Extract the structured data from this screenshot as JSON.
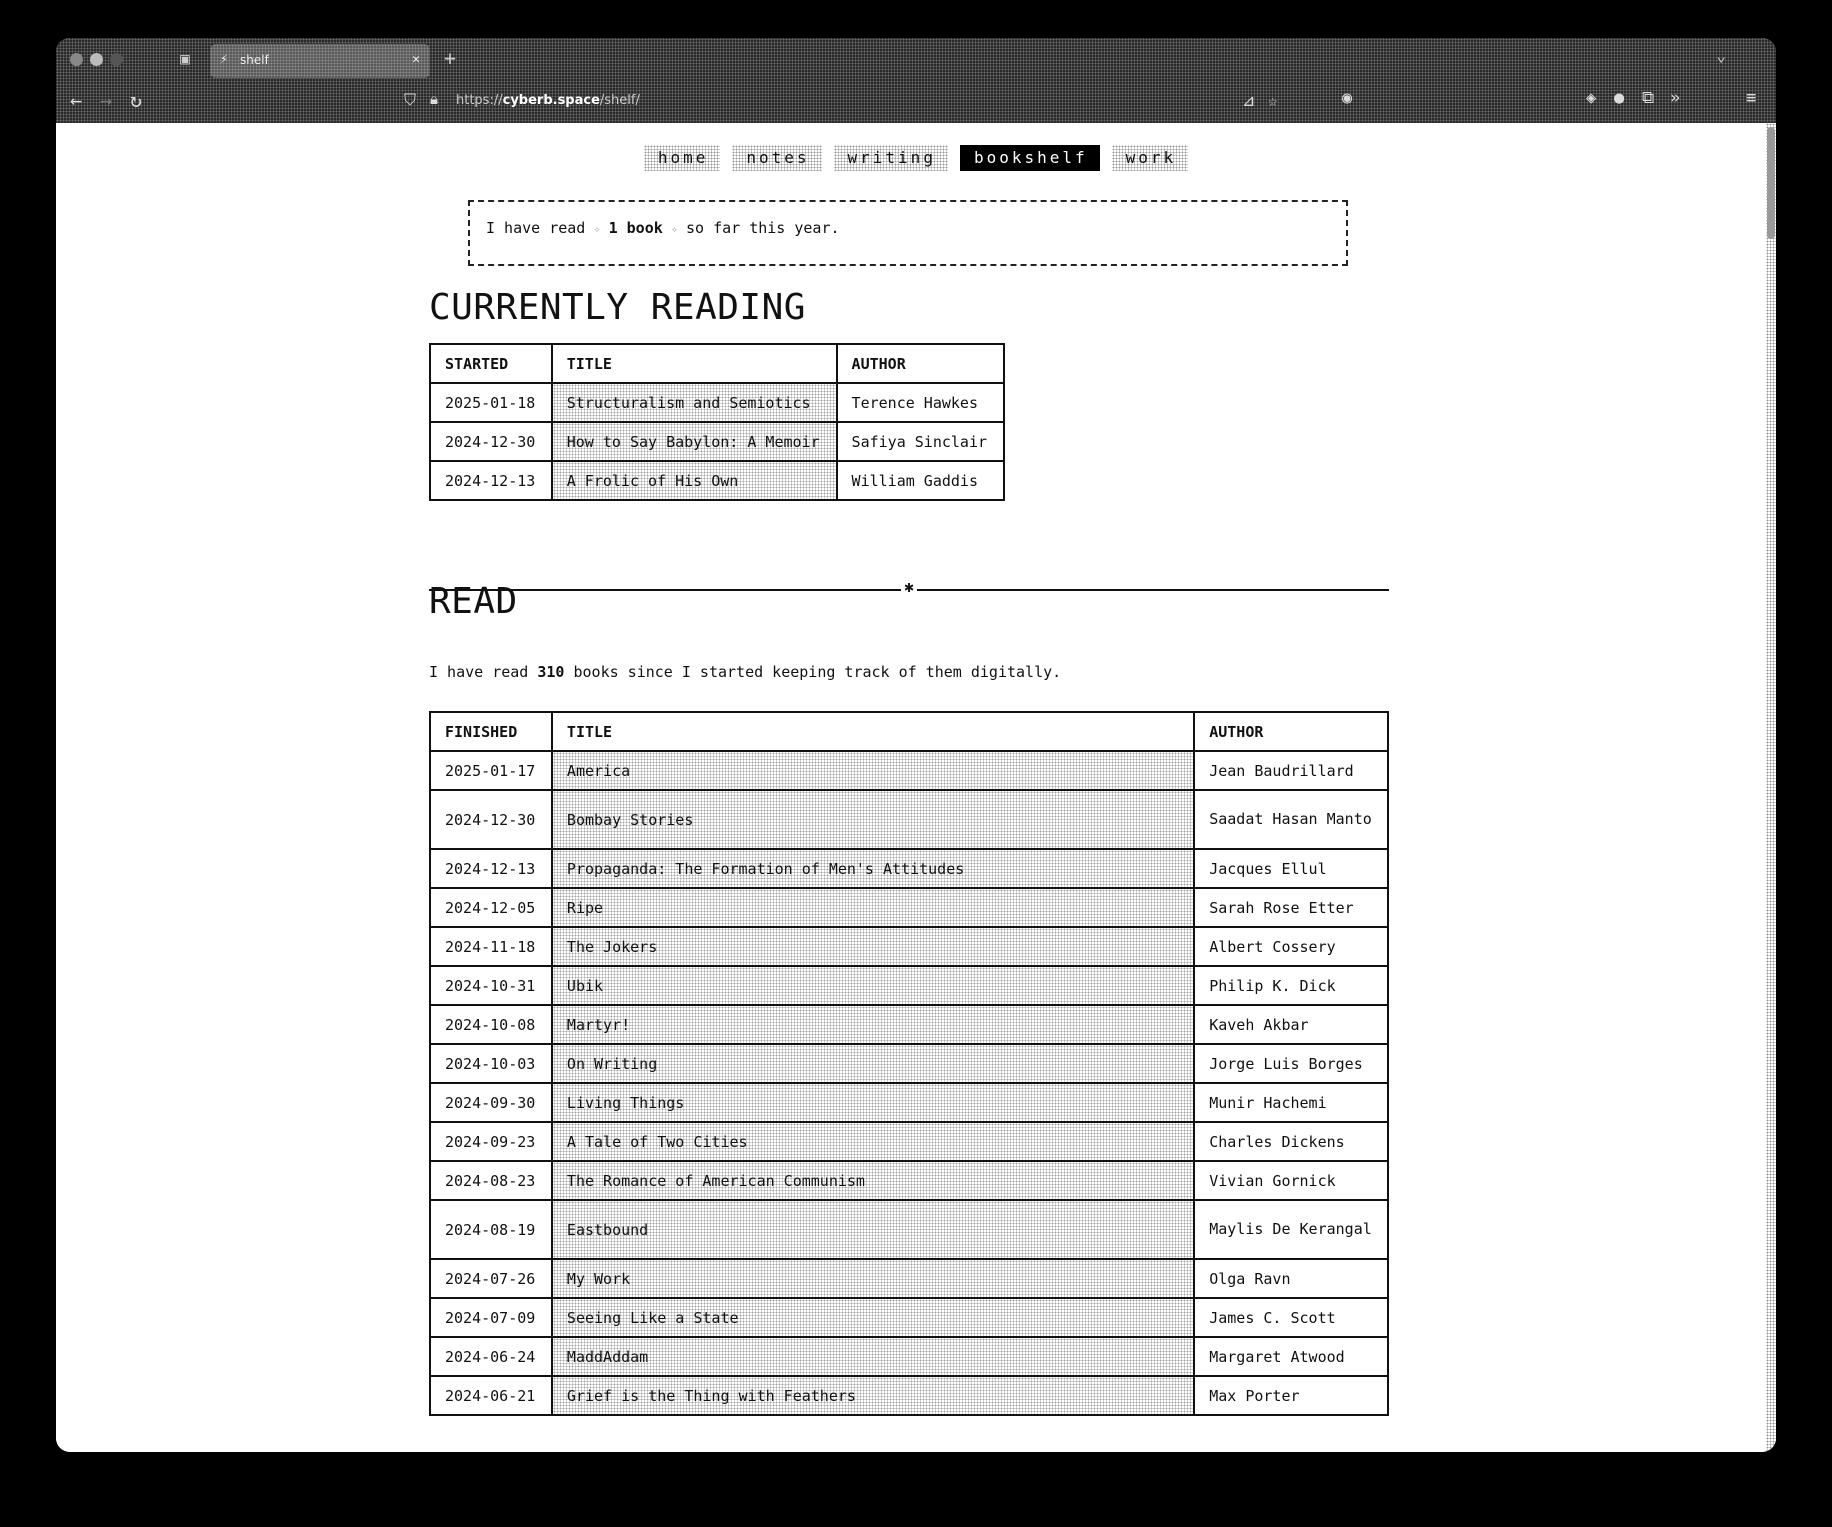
{
  "browser": {
    "tab_title": "shelf",
    "url_host": "cyberb.space",
    "url_scheme": "https://",
    "url_path": "/shelf/"
  },
  "nav": {
    "items": [
      {
        "label": "home"
      },
      {
        "label": "notes"
      },
      {
        "label": "writing"
      },
      {
        "label": "bookshelf"
      },
      {
        "label": "work"
      }
    ],
    "active": "bookshelf"
  },
  "notice": {
    "prefix": "I have read",
    "count": "1 book",
    "suffix": "so far this year."
  },
  "currently_reading": {
    "heading": "CURRENTLY READING",
    "columns": [
      "STARTED",
      "TITLE",
      "AUTHOR"
    ],
    "rows": [
      {
        "date": "2025-01-18",
        "title": "Structuralism and Semiotics",
        "author": "Terence Hawkes"
      },
      {
        "date": "2024-12-30",
        "title": "How to Say Babylon: A Memoir",
        "author": "Safiya Sinclair"
      },
      {
        "date": "2024-12-13",
        "title": "A Frolic of His Own",
        "author": "William Gaddis"
      }
    ]
  },
  "divider_symbol": "✱",
  "read": {
    "heading": "READ",
    "summary_prefix": "I have read",
    "summary_count": "310",
    "summary_suffix": "books since I started keeping track of them digitally.",
    "columns": [
      "FINISHED",
      "TITLE",
      "AUTHOR"
    ],
    "rows": [
      {
        "date": "2025-01-17",
        "title": "America",
        "author": "Jean Baudrillard"
      },
      {
        "date": "2024-12-30",
        "title": "Bombay Stories",
        "author": "Saadat Hasan Manto"
      },
      {
        "date": "2024-12-13",
        "title": "Propaganda: The Formation of Men's Attitudes",
        "author": "Jacques Ellul"
      },
      {
        "date": "2024-12-05",
        "title": "Ripe",
        "author": "Sarah Rose Etter"
      },
      {
        "date": "2024-11-18",
        "title": "The Jokers",
        "author": "Albert Cossery"
      },
      {
        "date": "2024-10-31",
        "title": "Ubik",
        "author": "Philip K. Dick"
      },
      {
        "date": "2024-10-08",
        "title": "Martyr!",
        "author": "Kaveh Akbar"
      },
      {
        "date": "2024-10-03",
        "title": "On Writing",
        "author": "Jorge Luis Borges"
      },
      {
        "date": "2024-09-30",
        "title": "Living Things",
        "author": "Munir Hachemi"
      },
      {
        "date": "2024-09-23",
        "title": "A Tale of Two Cities",
        "author": "Charles Dickens"
      },
      {
        "date": "2024-08-23",
        "title": "The Romance of American Communism",
        "author": "Vivian Gornick"
      },
      {
        "date": "2024-08-19",
        "title": "Eastbound",
        "author": "Maylis De Kerangal"
      },
      {
        "date": "2024-07-26",
        "title": "My Work",
        "author": "Olga Ravn"
      },
      {
        "date": "2024-07-09",
        "title": "Seeing Like a State",
        "author": "James C. Scott"
      },
      {
        "date": "2024-06-24",
        "title": "MaddAddam",
        "author": "Margaret Atwood"
      },
      {
        "date": "2024-06-21",
        "title": "Grief is the Thing with Feathers",
        "author": "Max Porter"
      }
    ]
  }
}
